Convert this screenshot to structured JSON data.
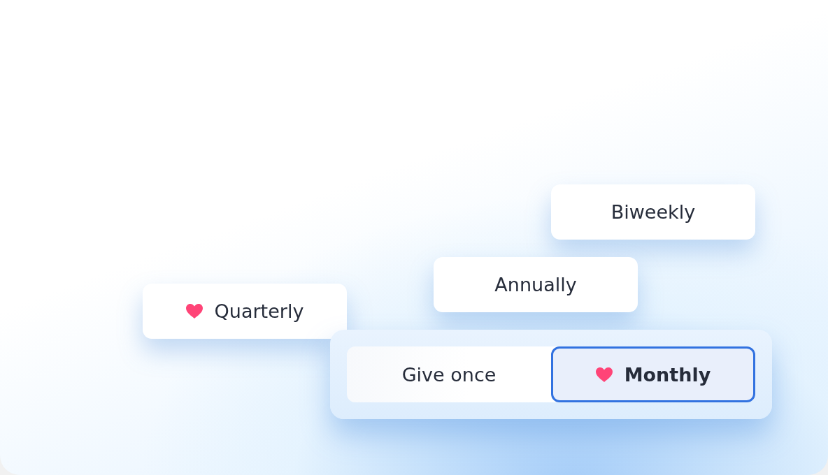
{
  "floating_options": [
    {
      "label": "Biweekly",
      "featured": false,
      "selected": false
    },
    {
      "label": "Annually",
      "featured": false,
      "selected": false
    },
    {
      "label": "Quarterly",
      "featured": true,
      "selected": false
    }
  ],
  "toggle": {
    "options": [
      {
        "label": "Give once",
        "featured": false,
        "selected": false
      },
      {
        "label": "Monthly",
        "featured": true,
        "selected": true
      }
    ]
  }
}
